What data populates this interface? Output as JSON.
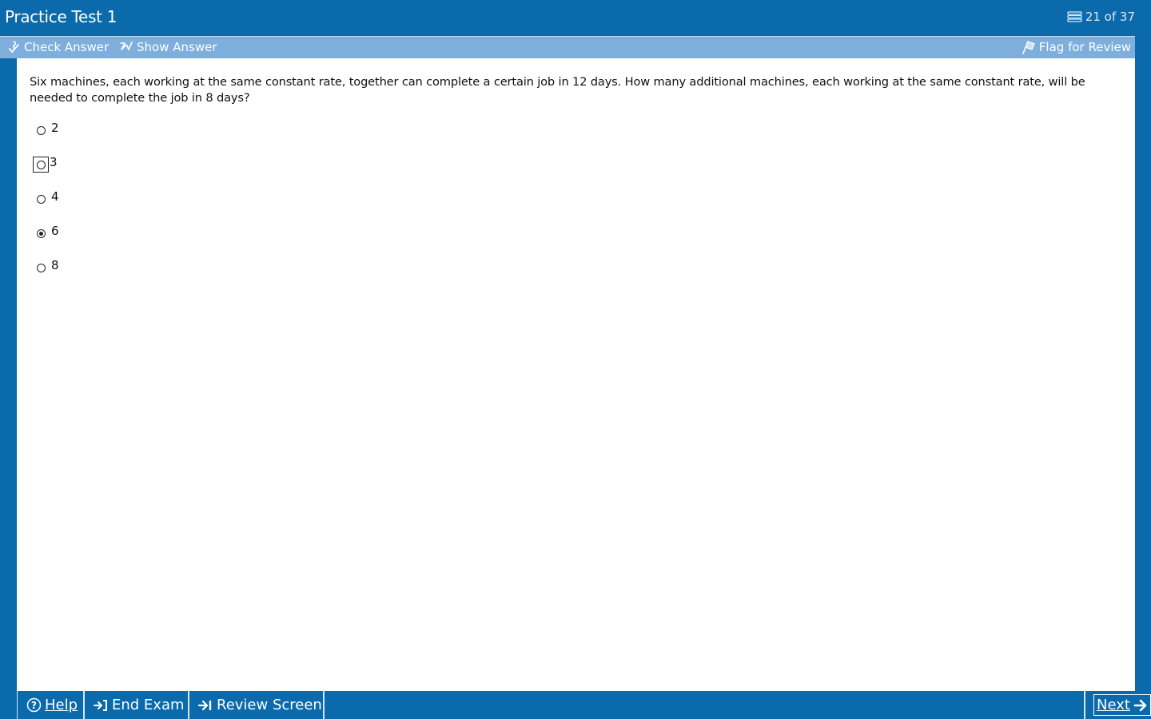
{
  "header": {
    "title": "Practice Test 1",
    "progress": "21 of 37",
    "progress_icon": "list-icon"
  },
  "toolbar": {
    "check_answer": "Check Answer",
    "show_answer": "Show Answer",
    "flag_for_review": "Flag for Review"
  },
  "question": {
    "text": "Six machines, each working at the same constant rate, together can complete a certain job in 12 days.  How many additional machines, each working at the same constant rate, will be needed to complete the job in 8 days?",
    "choices": [
      {
        "label": "2",
        "selected": false,
        "focused": false
      },
      {
        "label": "3",
        "selected": false,
        "focused": true
      },
      {
        "label": "4",
        "selected": false,
        "focused": false
      },
      {
        "label": "6",
        "selected": true,
        "focused": false
      },
      {
        "label": "8",
        "selected": false,
        "focused": false
      }
    ]
  },
  "footer": {
    "help": "Help",
    "end_exam": "End Exam",
    "review_screen": "Review Screen",
    "next": "Next"
  },
  "colors": {
    "primary_blue": "#0a6aac",
    "toolbar_blue": "#7eaedc",
    "content_bg": "#ffffff"
  }
}
